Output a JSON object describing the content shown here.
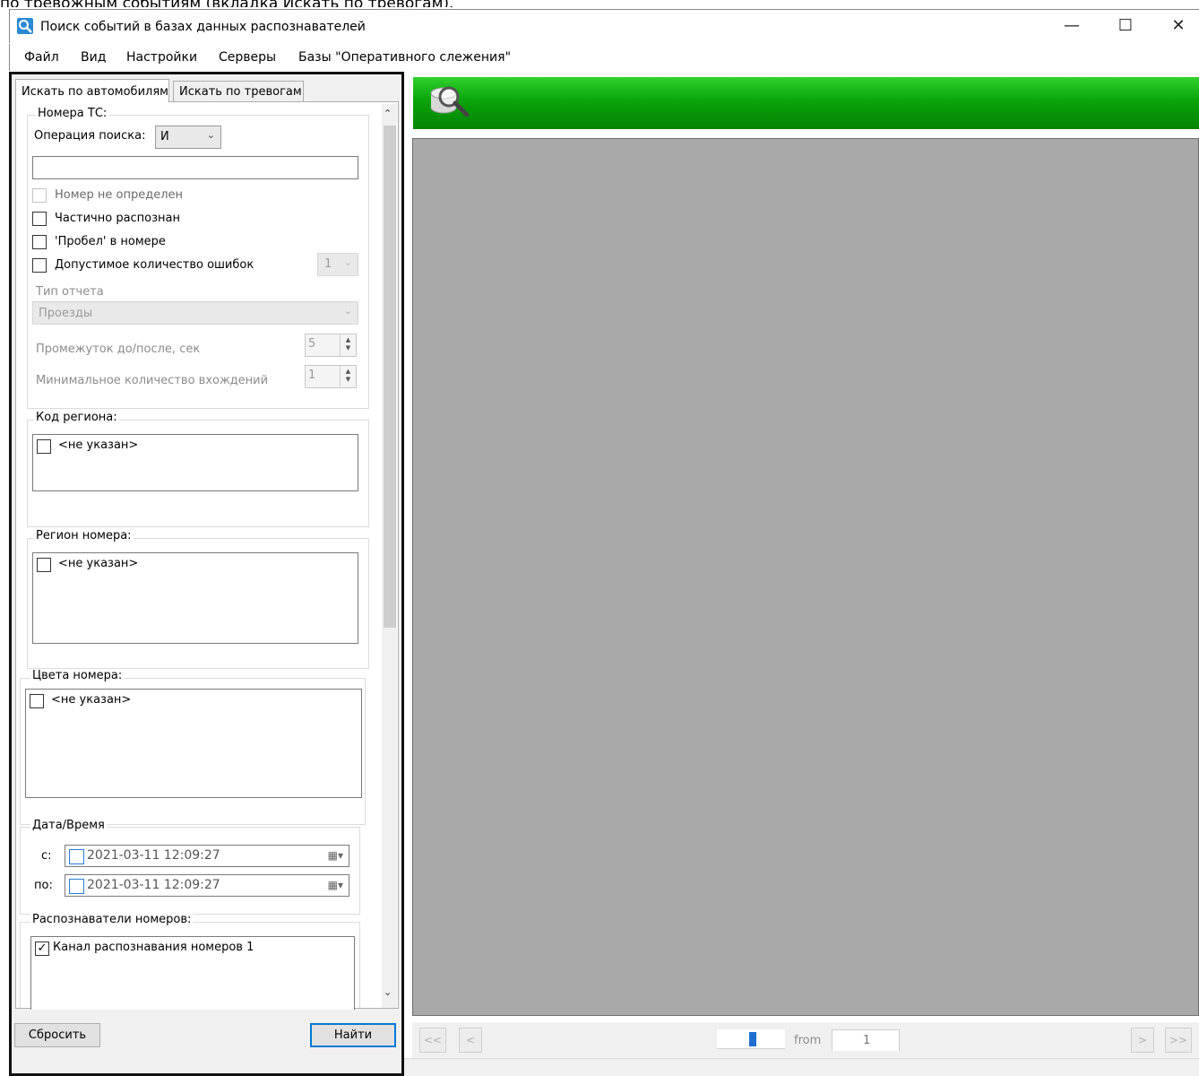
{
  "caption": "по тревожным событиям (вкладка Искать по тревогам).",
  "window": {
    "title": "Поиск событий в базах данных распознавателей",
    "minimize_glyph": "—",
    "maximize_glyph": "☐",
    "close_glyph": "✕"
  },
  "menu": [
    "Файл",
    "Вид",
    "Настройки",
    "Серверы",
    "Базы \"Оперативного слежения\""
  ],
  "tabs": [
    "Искать по автомобилям",
    "Искать по тревогам"
  ],
  "plates_group": {
    "label": "Номера ТС:",
    "operation_label": "Операция поиска:",
    "operation_value": "И",
    "plate_input_value": "",
    "not_detected_label": "Номер не определен",
    "partially_label": "Частично распознан",
    "space_label": "'Пробел' в номере",
    "errors_label": "Допустимое количество ошибок",
    "errors_value": "1",
    "report_type_label": "Тип отчета",
    "report_type_value": "Проезды",
    "interval_label": "Промежуток до/после, сек",
    "interval_value": "5",
    "min_count_label": "Минимальное количество вхождений",
    "min_count_value": "1"
  },
  "region_code": {
    "label": "Код региона:",
    "items": [
      "<не указан>"
    ]
  },
  "plate_region": {
    "label": "Регион номера:",
    "items": [
      "<не указан>"
    ]
  },
  "plate_colors": {
    "label": "Цвета номера:",
    "items": [
      "<не указан>"
    ]
  },
  "datetime": {
    "label": "Дата/Время",
    "from_label": "с:",
    "from_value": "2021-03-11 12:09:27",
    "to_label": "по:",
    "to_value": "2021-03-11 12:09:27"
  },
  "recognizers": {
    "label": "Распознаватели номеров:",
    "items": [
      {
        "label": "Канал распознавания номеров 1",
        "checked": true
      }
    ]
  },
  "buttons": {
    "reset": "Сбросить",
    "find": "Найти"
  },
  "pager": {
    "first": "<<",
    "prev": "<",
    "next": ">",
    "last": ">>",
    "from_label": "from",
    "total": "1",
    "current": ""
  },
  "colors": {
    "header_green": "#0aa40a",
    "viewer_gray": "#a9a9a9",
    "accent": "#0078d7"
  },
  "icons": [
    "search-icon",
    "app-icon",
    "chevron-down-icon",
    "calendar-icon",
    "scroll-up-icon",
    "scroll-down-icon"
  ]
}
